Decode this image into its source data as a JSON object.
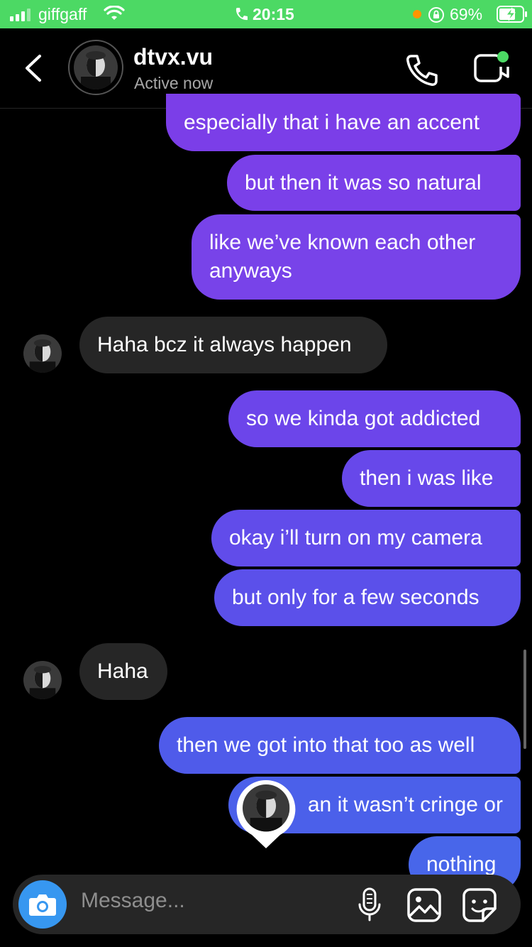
{
  "status_bar": {
    "carrier": "giffgaff",
    "time": "20:15",
    "battery": "69%"
  },
  "header": {
    "username": "dtvx.vu",
    "status": "Active now"
  },
  "messages": [
    {
      "from": "me",
      "text": "especially that i have an accent"
    },
    {
      "from": "me",
      "text": "but then it was so natural"
    },
    {
      "from": "me",
      "text": "like we’ve known each other anyways"
    },
    {
      "from": "them",
      "text": "Haha bcz it always happen"
    },
    {
      "from": "me",
      "text": "so we kinda got addicted"
    },
    {
      "from": "me",
      "text": "then i was like"
    },
    {
      "from": "me",
      "text": "okay i’ll turn on my camera"
    },
    {
      "from": "me",
      "text": "but only for a few seconds"
    },
    {
      "from": "them",
      "text": "Haha"
    },
    {
      "from": "me",
      "text": "then we got into that too as well"
    },
    {
      "from": "me",
      "text": "an it wasn’t cringe or"
    },
    {
      "from": "me",
      "text": "nothing"
    }
  ],
  "composer": {
    "placeholder": "Message..."
  },
  "colors": {
    "status_bar": "#4cd964",
    "bubble_purple": "#7b3ee8",
    "bubble_indigo": "#5550e8",
    "bubble_blue": "#4a63ea",
    "incoming_bubble": "#262626",
    "camera_button": "#3797f0"
  }
}
